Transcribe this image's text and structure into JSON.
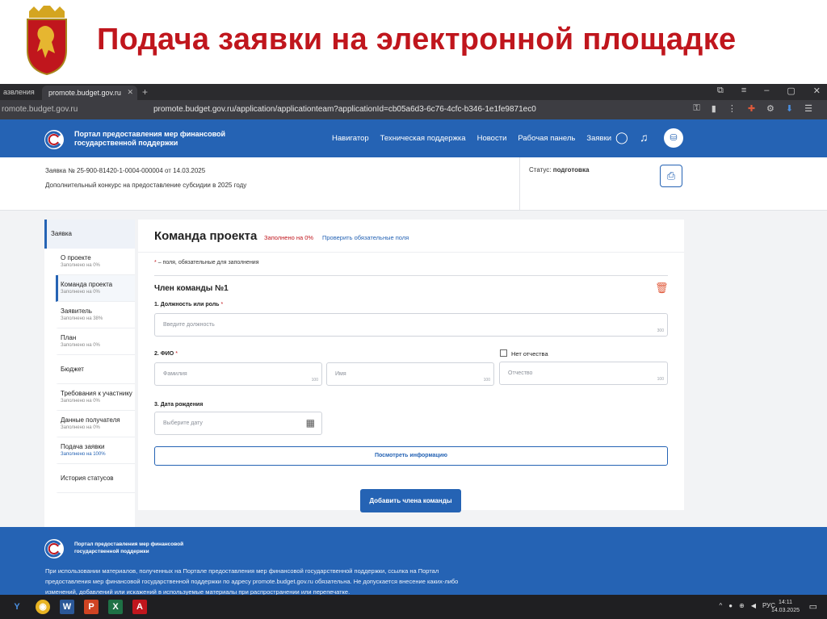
{
  "slide": {
    "title": "Подача заявки на электронной площадке"
  },
  "browser": {
    "prev_tab": "азвления",
    "active_tab": "promote.budget.gov.ru",
    "tab_close": "✕",
    "new_tab": "+",
    "address_domain": "romote.budget.gov.ru",
    "address_url": "promote.budget.gov.ru/application/applicationteam?applicationId=cb05a6d3-6c76-4cfc-b346-1e1fe9871ec0"
  },
  "portal": {
    "name": "Портал предоставления мер финансовой государственной поддержки",
    "nav": [
      "Навигатор",
      "Техническая поддержка",
      "Новости",
      "Рабочая панель",
      "Заявки"
    ]
  },
  "application": {
    "number_line": "Заявка № 25-900-81420-1-0004-000004 от 14.03.2025",
    "contest_line": "Дополнительный конкурс на предоставление субсидии в 2025 году",
    "status_label": "Статус:",
    "status_value": "подготовка"
  },
  "sidebar": {
    "top": "Заявка",
    "items": [
      {
        "label": "О проекте",
        "sub": "Заполнено на 0%"
      },
      {
        "label": "Команда проекта",
        "sub": "Заполнено на 0%"
      },
      {
        "label": "Заявитель",
        "sub": "Заполнено на 38%"
      },
      {
        "label": "План",
        "sub": "Заполнено на 0%"
      },
      {
        "label": "Бюджет",
        "sub": ""
      },
      {
        "label": "Требования к участнику",
        "sub": "Заполнено на 0%"
      },
      {
        "label": "Данные получателя",
        "sub": "Заполнено на 0%"
      },
      {
        "label": "Подача заявки",
        "sub": "Заполнено на 100%"
      },
      {
        "label": "История статусов",
        "sub": ""
      }
    ]
  },
  "form": {
    "title": "Команда проекта",
    "fill_status": "Заполнено на 0%",
    "check_link": "Проверить обязательные поля",
    "required_note": "– поля, обязательные для заполнения",
    "required_star": "*",
    "member_title": "Член команды №1",
    "position_label": "1. Должность или роль",
    "position_placeholder": "Введите должность",
    "position_count": "300",
    "fio_label": "2. ФИО",
    "no_patronymic": "Нет отчества",
    "surname_placeholder": "Фамилия",
    "surname_count": "100",
    "name_placeholder": "Имя",
    "name_count": "100",
    "patronymic_placeholder": "Отчество",
    "patronymic_count": "100",
    "birth_label": "3. Дата рождения",
    "birth_placeholder": "Выберите дату",
    "view_info_button": "Посмотреть информацию",
    "add_member_button": "Добавить члена команды"
  },
  "footer": {
    "name": "Портал предоставления мер финансовой государственной поддержки",
    "text": "При использовании материалов, полученных на Портале предоставления мер финансовой государственной поддержки, ссылка на Портал предоставления мер финансовой государственной поддержки по адресу promote.budget.gov.ru обязательна. Не допускается внесение каких-либо изменений, добавлений или искажений в используемые материалы при распространении или перепечатке."
  },
  "taskbar": {
    "lang": "РУС",
    "time": "14:11",
    "date": "14.03.2025"
  },
  "colors": {
    "accent": "#2563b4",
    "title_red": "#c0161d",
    "warning": "#e05a3b"
  }
}
